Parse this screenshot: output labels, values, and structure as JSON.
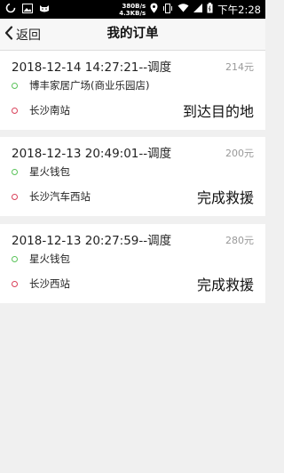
{
  "status_bar": {
    "speed_up": "380B/s",
    "speed_down": "4.3KB/s",
    "time": "下午2:28",
    "icons": [
      "loading-icon",
      "image-icon",
      "cat-icon",
      "location-icon",
      "vibrate-icon",
      "wifi-icon",
      "signal-icon",
      "battery-icon"
    ]
  },
  "header": {
    "back_label": "返回",
    "title": "我的订单"
  },
  "orders": [
    {
      "datetime_type": "2018-12-14 14:27:21--调度",
      "price": "214元",
      "from": "博丰家居广场(商业乐园店)",
      "to": "长沙南站",
      "status": "到达目的地"
    },
    {
      "datetime_type": "2018-12-13 20:49:01--调度",
      "price": "200元",
      "from": "星火钱包",
      "to": "长沙汽车西站",
      "status": "完成救援"
    },
    {
      "datetime_type": "2018-12-13 20:27:59--调度",
      "price": "280元",
      "from": "星火钱包",
      "to": "长沙西站",
      "status": "完成救援"
    }
  ],
  "colors": {
    "origin_dot": "#5ac35a",
    "destination_dot": "#d9415a",
    "background": "#f0f0f0"
  }
}
